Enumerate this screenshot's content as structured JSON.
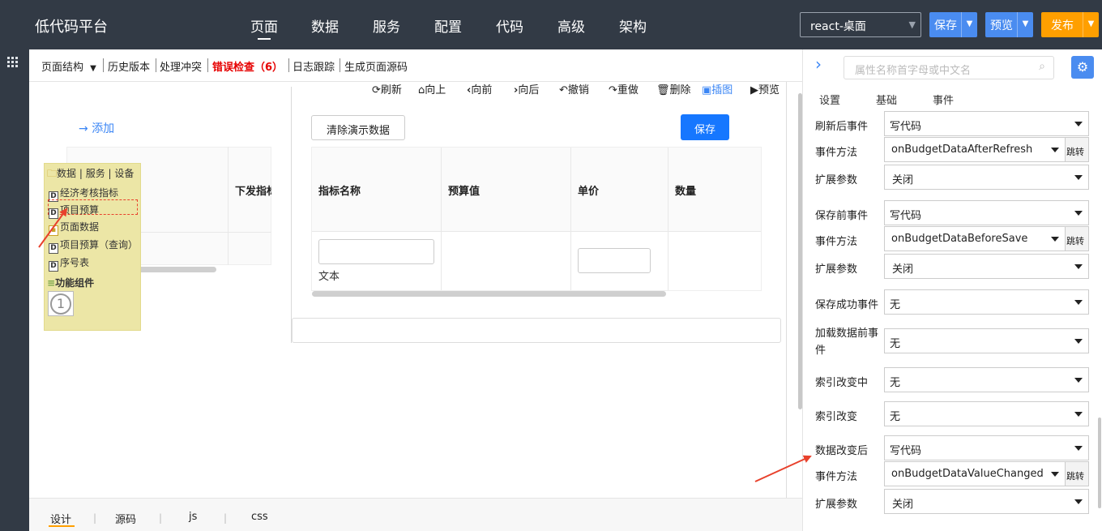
{
  "app": {
    "title": "低代码平台"
  },
  "nav": {
    "items": [
      "页面",
      "数据",
      "服务",
      "配置",
      "代码",
      "高级",
      "架构"
    ]
  },
  "header": {
    "project": "react-桌面",
    "save": "保存",
    "preview": "预览",
    "publish": "发布"
  },
  "subbar": {
    "structure": "页面结构",
    "history": "历史版本",
    "conflict": "处理冲突",
    "errors": "错误检查（6）",
    "log": "日志跟踪",
    "source": "生成页面源码"
  },
  "toolbar": {
    "refresh": "刷新",
    "up": "向上",
    "forward": "向前",
    "back": "向后",
    "undo": "撤销",
    "redo": "重做",
    "delete": "删除",
    "screenshot": "插图",
    "preview": "预览"
  },
  "left_canvas": {
    "add": "添加",
    "col_header": "下发指标"
  },
  "tree": {
    "header": "数据 | 服务 | 设备",
    "items": [
      "经济考核指标",
      "项目预算",
      "页面数据",
      "项目预算（查询）",
      "序号表"
    ],
    "section": "功能组件",
    "badge": "1"
  },
  "center": {
    "clear": "清除演示数据",
    "save": "保存",
    "columns": [
      "指标名称",
      "预算值",
      "单价",
      "数量"
    ],
    "cell_label": "文本"
  },
  "right_panel": {
    "search_placeholder": "属性名称首字母或中文名",
    "tabs": [
      "设置",
      "基础",
      "事件"
    ],
    "jump": "跳转",
    "rows": [
      {
        "label": "刷新后事件",
        "value": "写代码"
      },
      {
        "label": "事件方法",
        "value": "onBudgetDataAfterRefresh"
      },
      {
        "label": "扩展参数",
        "value": "关闭"
      },
      {
        "label": "保存前事件",
        "value": "写代码"
      },
      {
        "label": "事件方法",
        "value": "onBudgetDataBeforeSave"
      },
      {
        "label": "扩展参数",
        "value": "关闭"
      },
      {
        "label": "保存成功事件",
        "value": "无"
      },
      {
        "label": "加载数据前事件",
        "value": "无"
      },
      {
        "label": "索引改变中",
        "value": "无"
      },
      {
        "label": "索引改变",
        "value": "无"
      },
      {
        "label": "数据改变后",
        "value": "写代码"
      },
      {
        "label": "事件方法",
        "value": "onBudgetDataValueChanged"
      },
      {
        "label": "扩展参数",
        "value": "关闭"
      }
    ]
  },
  "bottom": {
    "tabs": [
      "设计",
      "源码",
      "js",
      "css"
    ]
  },
  "colors": {
    "topbar": "#323a45",
    "blue": "#1677ff",
    "orange": "#ff9f00",
    "error": "#e60000",
    "tree": "#ece6a6",
    "arrow": "#e8412c"
  }
}
